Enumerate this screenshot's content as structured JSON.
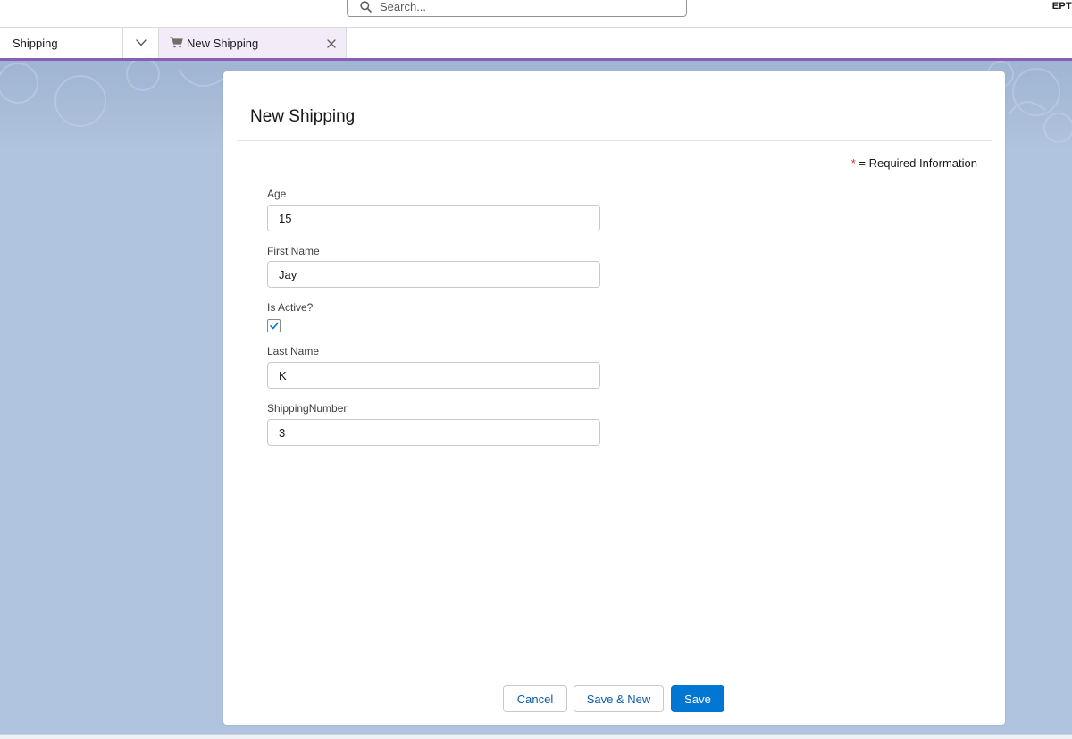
{
  "header": {
    "search": {
      "placeholder": "Search...",
      "value": ""
    },
    "user_label": "EPT"
  },
  "tabs": {
    "app_name": "Shipping",
    "active_tab": {
      "label": "New Shipping",
      "icon": "cart-icon"
    }
  },
  "colors": {
    "accent": "#8b5cba",
    "brand_button": "#0176d3",
    "required": "#c23934",
    "background": "#b0c4df"
  },
  "form": {
    "title": "New Shipping",
    "required_note": "= Required Information",
    "required_symbol": "*",
    "fields": {
      "age": {
        "label": "Age",
        "value": "15"
      },
      "first_name": {
        "label": "First Name",
        "value": "Jay"
      },
      "is_active": {
        "label": "Is Active?",
        "checked": true
      },
      "last_name": {
        "label": "Last Name",
        "value": "K"
      },
      "shipping_number": {
        "label": "ShippingNumber",
        "value": "3"
      }
    }
  },
  "footer": {
    "cancel_label": "Cancel",
    "save_new_label": "Save & New",
    "save_label": "Save"
  }
}
